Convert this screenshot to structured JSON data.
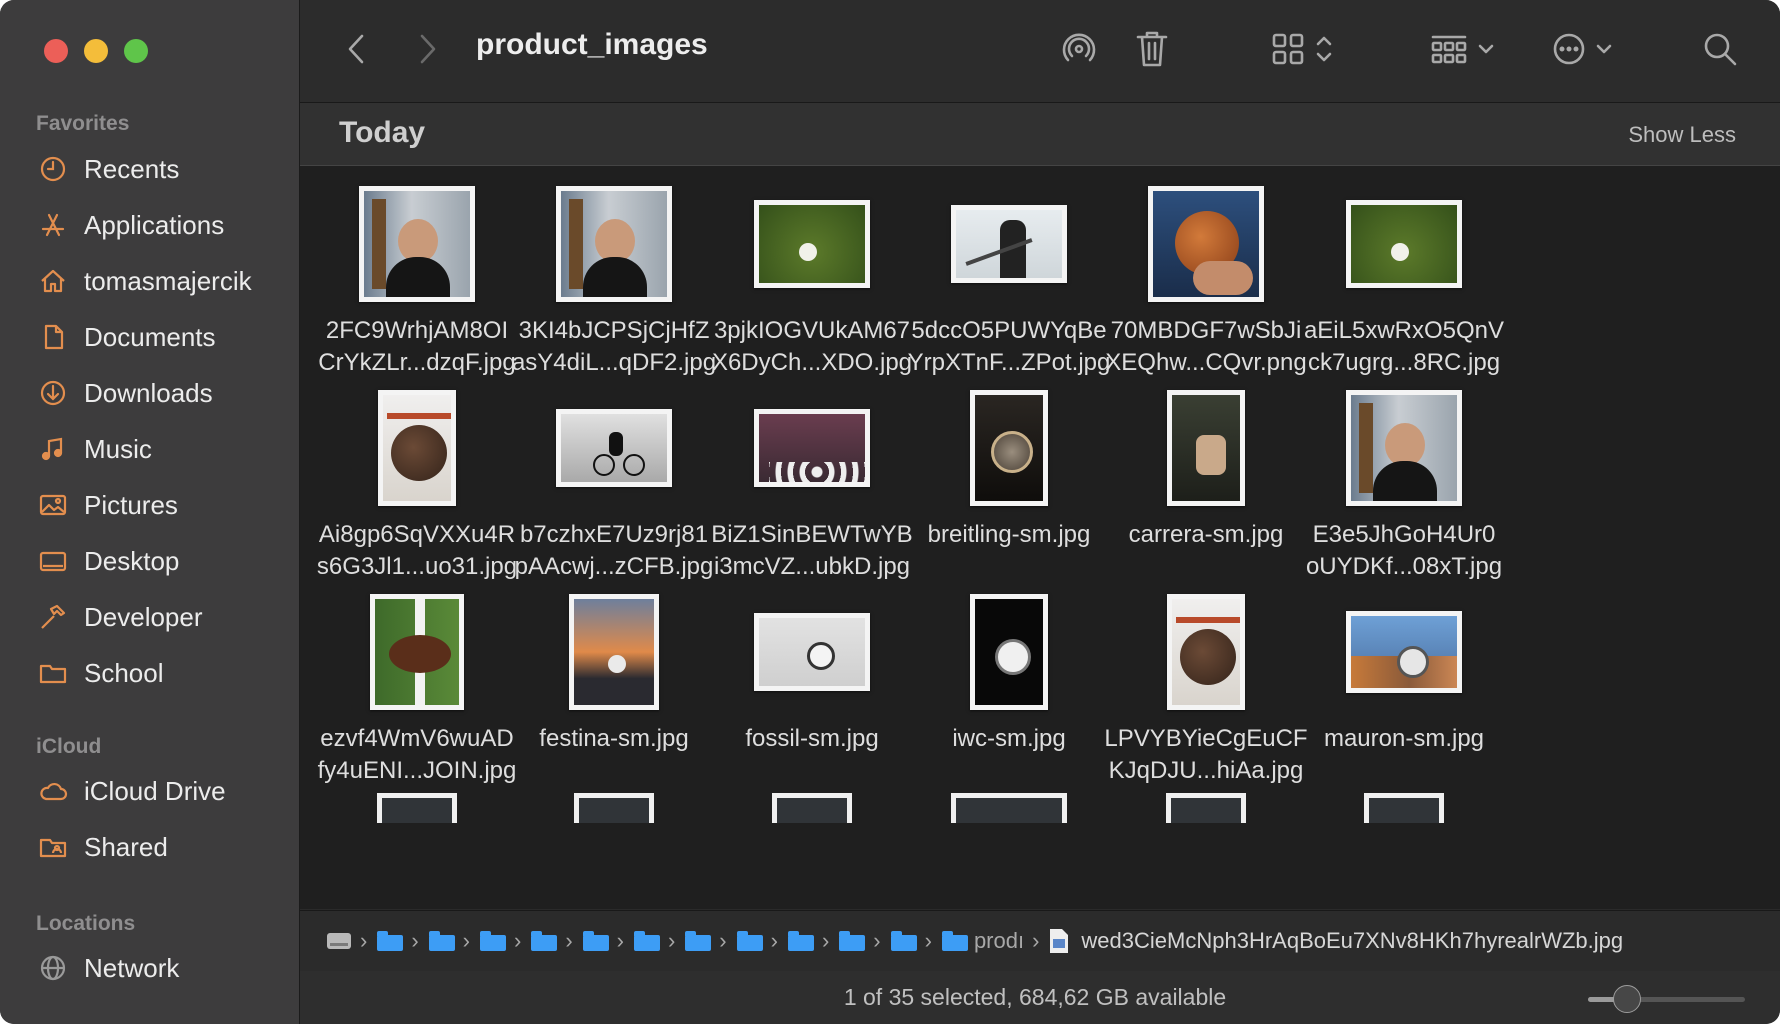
{
  "window": {
    "title": "product_images"
  },
  "sidebar": {
    "sections": [
      {
        "label": "Favorites",
        "items": [
          {
            "label": "Recents",
            "icon": "clock-icon"
          },
          {
            "label": "Applications",
            "icon": "applications-icon"
          },
          {
            "label": "tomasmajercik",
            "icon": "home-icon"
          },
          {
            "label": "Documents",
            "icon": "document-icon"
          },
          {
            "label": "Downloads",
            "icon": "download-icon"
          },
          {
            "label": "Music",
            "icon": "music-icon"
          },
          {
            "label": "Pictures",
            "icon": "pictures-icon"
          },
          {
            "label": "Desktop",
            "icon": "desktop-icon"
          },
          {
            "label": "Developer",
            "icon": "hammer-icon"
          },
          {
            "label": "School",
            "icon": "folder-icon"
          }
        ]
      },
      {
        "label": "iCloud",
        "items": [
          {
            "label": "iCloud Drive",
            "icon": "cloud-icon"
          },
          {
            "label": "Shared",
            "icon": "shared-folder-icon"
          }
        ]
      },
      {
        "label": "Locations",
        "items": [
          {
            "label": "Network",
            "icon": "globe-icon"
          }
        ]
      }
    ]
  },
  "toolbar": {
    "icons": [
      "back-icon",
      "forward-icon",
      "airdrop-icon",
      "trash-icon",
      "grid-view-icon",
      "group-icon",
      "more-icon",
      "search-icon"
    ]
  },
  "content": {
    "group_title": "Today",
    "show_less_label": "Show Less",
    "files": [
      {
        "line1": "2FC9WrhjAM8OI",
        "line2": "CrYkZLr...dzqF.jpg",
        "thumb": "guitar-portrait"
      },
      {
        "line1": "3KI4bJCPSjCjHfZ",
        "line2": "asY4diL...qDF2.jpg",
        "thumb": "guitar-portrait"
      },
      {
        "line1": "3pjkIOGVUkAM67",
        "line2": "X6DyCh...XDO.jpg",
        "thumb": "baseball-grass"
      },
      {
        "line1": "5dccO5PUWYqBe",
        "line2": "YrpXTnF...ZPot.jpg",
        "thumb": "hockey-player"
      },
      {
        "line1": "70MBDGF7wSbJi",
        "line2": "XEQhw...CQvr.png",
        "thumb": "handball"
      },
      {
        "line1": "aEiL5xwRxO5QnV",
        "line2": "ck7ugrg...8RC.jpg",
        "thumb": "baseball-grass"
      },
      {
        "line1": "Ai8gp6SqVXXu4R",
        "line2": "s6G3Jl1...uo31.jpg",
        "thumb": "basketball-hoop"
      },
      {
        "line1": "b7czhxE7Uz9rj81",
        "line2": "pAAcwj...zCFB.jpg",
        "thumb": "cyclist"
      },
      {
        "line1": "BiZ1SinBEWTwYB",
        "line2": "i3mcVZ...ubkD.jpg",
        "thumb": "lacrosse"
      },
      {
        "line1": "breitling-sm.jpg",
        "line2": "",
        "thumb": "watch-box"
      },
      {
        "line1": "carrera-sm.jpg",
        "line2": "",
        "thumb": "watch-suit"
      },
      {
        "line1": "E3e5JhGoH4Ur0",
        "line2": "oUYDKf...08xT.jpg",
        "thumb": "guitar-portrait"
      },
      {
        "line1": "ezvf4WmV6wuAD",
        "line2": "fy4uENI...JOIN.jpg",
        "thumb": "football"
      },
      {
        "line1": "festina-sm.jpg",
        "line2": "",
        "thumb": "sunset-watch"
      },
      {
        "line1": "fossil-sm.jpg",
        "line2": "",
        "thumb": "watch-white"
      },
      {
        "line1": "iwc-sm.jpg",
        "line2": "",
        "thumb": "watch-dark"
      },
      {
        "line1": "LPVYBYieCgEuCF",
        "line2": "KJqDJU...hiAa.jpg",
        "thumb": "basketball-hoop"
      },
      {
        "line1": "mauron-sm.jpg",
        "line2": "",
        "thumb": "watch-mountain"
      }
    ]
  },
  "pathbar": {
    "folders_count_label": "prodı",
    "last_file": "wed3CieMcNph3HrAqBoEu7XNv8HKh7hyrealrWZb.jpg"
  },
  "status": {
    "text": "1 of 35 selected, 684,62 GB available",
    "zoom_level": 0.25
  },
  "colors": {
    "close": "#ec5f58",
    "minimize": "#f4bd3a",
    "zoom": "#5fc54a",
    "accent": "#3d9df5",
    "sidebar_icon": "#e38e4e"
  }
}
